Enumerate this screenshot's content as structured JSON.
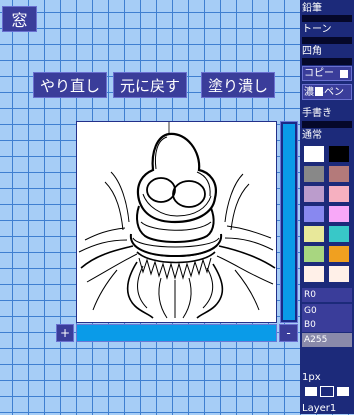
{
  "toolbar": {
    "window_label": "窓",
    "redo_label": "やり直し",
    "undo_label": "元に戻す",
    "fill_label": "塗り潰し"
  },
  "canvas": {
    "zoom_in_label": "+",
    "zoom_out_label": "-"
  },
  "tools": {
    "pencil_label": "鉛筆",
    "tone_label": "トーン",
    "square_label": "四角",
    "copy_label": "コピー",
    "pen_label": "濃いペン",
    "handwriting_label": "手書き",
    "mode_label": "通常"
  },
  "palette": {
    "colors": [
      "#ffffff",
      "#000000",
      "#888888",
      "#b47a7a",
      "#bb9ccc",
      "#f6b0c0",
      "#8888f0",
      "#f8a8f8",
      "#e8e89a",
      "#38c8c8",
      "#a8d680",
      "#f0a020",
      "#fff0e8",
      "#fff0e8"
    ]
  },
  "color_fields": {
    "r": "R0",
    "g": "G0",
    "b": "B0",
    "a": "A255"
  },
  "brush": {
    "size_label": "1px"
  },
  "layer": {
    "label": "Layer1"
  }
}
